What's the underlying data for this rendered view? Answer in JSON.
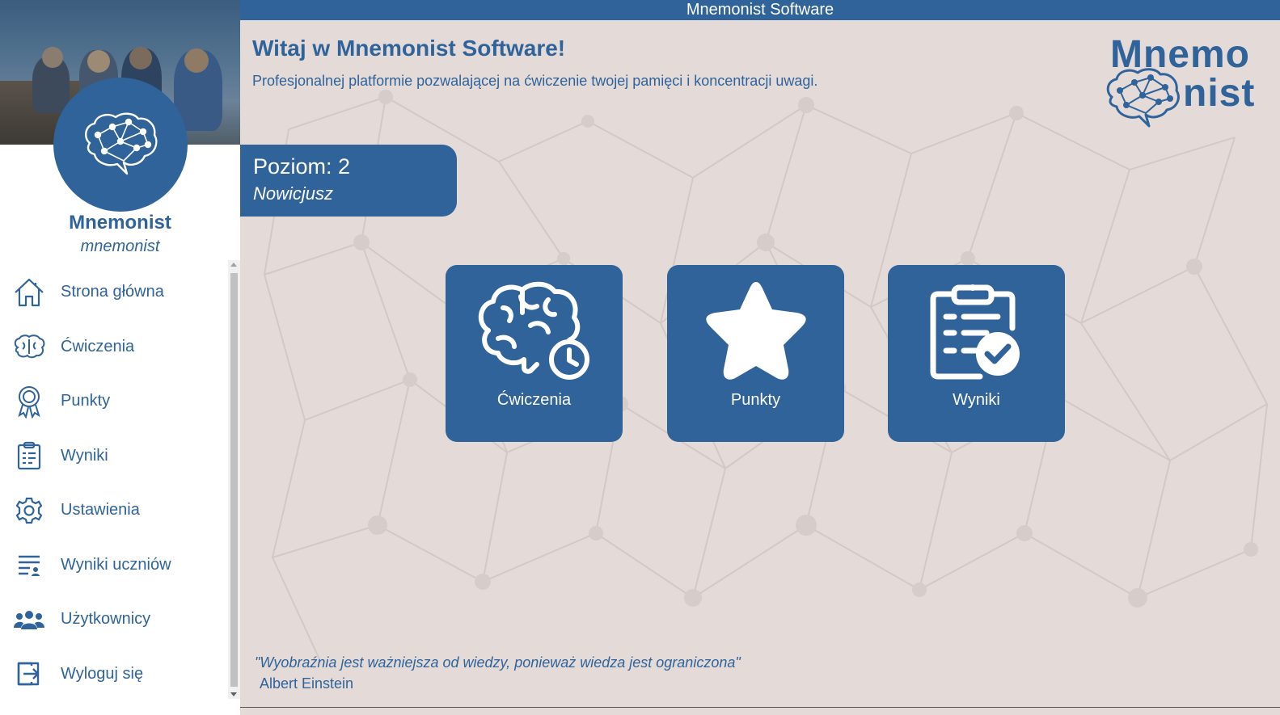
{
  "app": {
    "title": "Mnemonist Software"
  },
  "profile": {
    "name": "Mnemonist",
    "login": "mnemonist"
  },
  "nav": {
    "items": [
      {
        "label": "Strona główna",
        "icon": "home-icon"
      },
      {
        "label": "Ćwiczenia",
        "icon": "brain-icon"
      },
      {
        "label": "Punkty",
        "icon": "award-icon"
      },
      {
        "label": "Wyniki",
        "icon": "clipboard-icon"
      },
      {
        "label": "Ustawienia",
        "icon": "gear-icon"
      },
      {
        "label": "Wyniki uczniów",
        "icon": "list-user-icon"
      },
      {
        "label": "Użytkownicy",
        "icon": "users-icon"
      },
      {
        "label": "Wyloguj się",
        "icon": "logout-icon"
      }
    ]
  },
  "main": {
    "welcome": "Witaj w Mnemonist Software!",
    "subtitle": "Profesjonalnej platformie pozwalającej na ćwiczenie twojej pamięci i koncentracji uwagi.",
    "logo": {
      "line1": "Mnemo",
      "line2": "nist"
    },
    "level": {
      "text": "Poziom: 2",
      "rank": "Nowicjusz"
    },
    "tiles": [
      {
        "label": "Ćwiczenia",
        "icon": "brain-clock-icon"
      },
      {
        "label": "Punkty",
        "icon": "star-icon"
      },
      {
        "label": "Wyniki",
        "icon": "clipboard-check-icon"
      }
    ],
    "quote": "\"Wyobraźnia jest ważniejsza od wiedzy, ponieważ wiedza jest ograniczona\"",
    "quote_author": "Albert Einstein"
  },
  "colors": {
    "accent": "#2f639a",
    "background": "#e4dbd8",
    "sidebar": "#ffffff"
  }
}
